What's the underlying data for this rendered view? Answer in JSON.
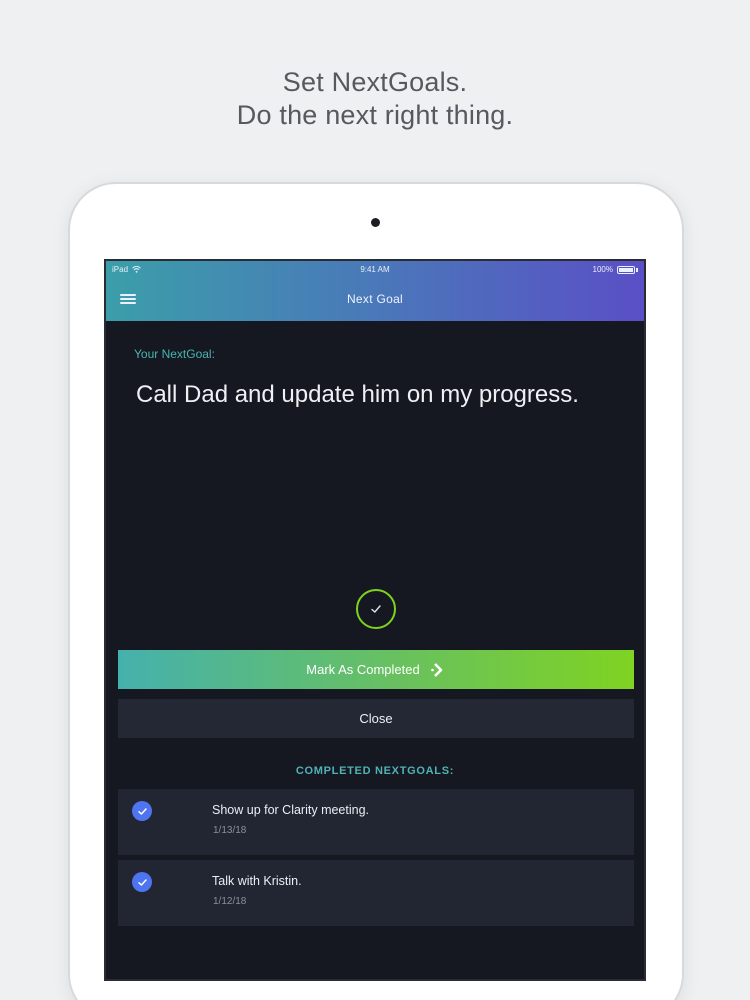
{
  "headline": {
    "line1": "Set NextGoals.",
    "line2": "Do the next right thing."
  },
  "status_bar": {
    "carrier": "iPad",
    "time": "9:41 AM",
    "battery": "100%"
  },
  "nav": {
    "title": "Next Goal",
    "menu_icon": "hamburger-menu-icon"
  },
  "goal": {
    "label": "Your NextGoal:",
    "text": "Call Dad and update him on my progress."
  },
  "actions": {
    "mark_completed": "Mark As Completed",
    "close": "Close"
  },
  "completed": {
    "title": "COMPLETED NEXTGOALS:",
    "items": [
      {
        "text": "Show up for Clarity meeting.",
        "date": "1/13/18"
      },
      {
        "text": "Talk with Kristin.",
        "date": "1/12/18"
      }
    ]
  },
  "colors": {
    "accent_teal": "#49b4b0",
    "accent_green": "#7ed321",
    "check_blue": "#4f74ef",
    "screen_bg": "#161821"
  }
}
